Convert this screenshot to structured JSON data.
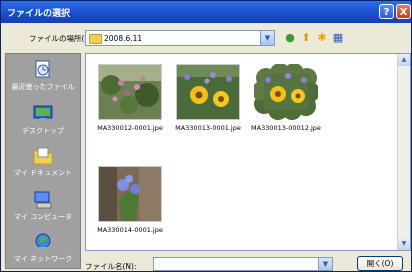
{
  "window": {
    "title": "ファイルの選択",
    "help_label": "?",
    "close_label": "X"
  },
  "lookin": {
    "label": "ファイルの場所(I):",
    "value": "2008.6.11"
  },
  "toolbar": {
    "back_glyph": "●",
    "up_glyph": "⬆",
    "new_folder_glyph": "✱",
    "view_glyph": "▦"
  },
  "places": [
    {
      "label": "最近使ったファイル",
      "icon": "recent-documents-icon"
    },
    {
      "label": "デスクトップ",
      "icon": "desktop-icon"
    },
    {
      "label": "マイ ドキュメント",
      "icon": "my-documents-icon"
    },
    {
      "label": "マイ コンピュータ",
      "icon": "my-computer-icon"
    },
    {
      "label": "マイ ネットワーク",
      "icon": "my-network-icon"
    }
  ],
  "files": [
    {
      "name": "MA330012-0001.jpe"
    },
    {
      "name": "MA330013-0001.jpe"
    },
    {
      "name": "MA330013-00012.jpe"
    },
    {
      "name": "MA330014-0001.jpe"
    }
  ],
  "filename": {
    "label": "ファイル名(N):",
    "value": ""
  },
  "buttons": {
    "open_label": "開く(O)"
  },
  "colors": {
    "titlebar": "#2458d1",
    "dialog_bg": "#ece9d8",
    "places_bg": "#a0a0a0"
  }
}
